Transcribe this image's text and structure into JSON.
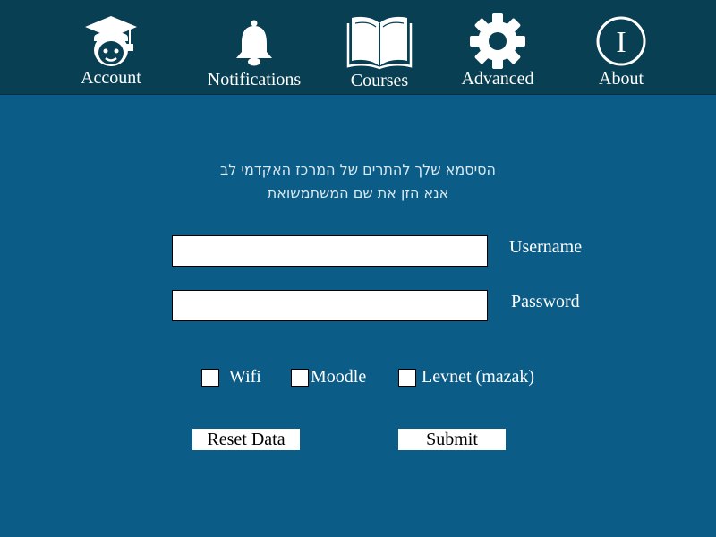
{
  "nav": {
    "items": [
      {
        "label": "Account",
        "icon": "student-graduation-icon"
      },
      {
        "label": "Notifications",
        "icon": "bell-icon"
      },
      {
        "label": "Courses",
        "icon": "open-book-icon"
      },
      {
        "label": "Advanced",
        "icon": "gear-icon"
      },
      {
        "label": "About",
        "icon": "info-icon"
      }
    ],
    "about_glyph": "I"
  },
  "message": {
    "line1": "הסיסמא שלך להתרים של המרכז האקדמי לב",
    "line2": "אנא הזן את שם המשתמשואת"
  },
  "form": {
    "username_label": "Username",
    "username_value": "",
    "password_label": "Password",
    "password_value": ""
  },
  "options": [
    {
      "label": "Wifi",
      "checked": false
    },
    {
      "label": "Moodle",
      "checked": false
    },
    {
      "label": "Levnet (mazak)",
      "checked": false
    }
  ],
  "buttons": {
    "reset_label": "Reset Data",
    "submit_label": "Submit"
  },
  "colors": {
    "background": "#0b5d87",
    "header": "#093f52"
  }
}
